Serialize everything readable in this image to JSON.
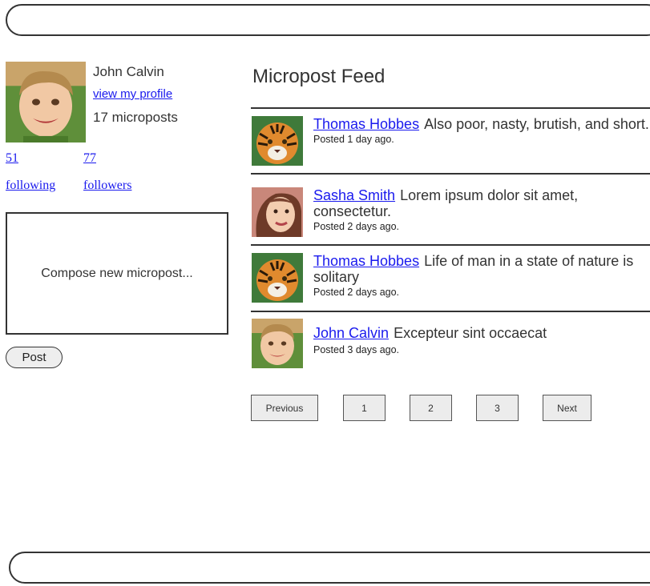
{
  "user": {
    "name": "John Calvin",
    "profile_link": "view my profile",
    "microposts": "17 microposts",
    "following_count": "51",
    "following_label": "following",
    "followers_count": "77",
    "followers_label": "followers"
  },
  "compose": {
    "placeholder": "Compose new micropost...",
    "post_label": "Post"
  },
  "feed": {
    "title": "Micropost Feed",
    "items": [
      {
        "author": "Thomas Hobbes",
        "text": "Also poor, nasty, brutish, and short.",
        "posted": "Posted 1 day ago.",
        "avatar": "tiger-avatar"
      },
      {
        "author": "Sasha Smith",
        "text": "Lorem ipsum dolor sit amet, consectetur.",
        "posted": "Posted 2 days ago.",
        "avatar": "woman-avatar"
      },
      {
        "author": "Thomas Hobbes",
        "text": "Life of man in a state of nature is solitary",
        "posted": "Posted 2 days ago.",
        "avatar": "tiger-avatar"
      },
      {
        "author": "John Calvin",
        "text": "Excepteur sint occaecat",
        "posted": "Posted 3 days ago.",
        "avatar": "boy-avatar"
      }
    ]
  },
  "pagination": {
    "previous": "Previous",
    "pages": [
      "1",
      "2",
      "3"
    ],
    "next": "Next"
  }
}
